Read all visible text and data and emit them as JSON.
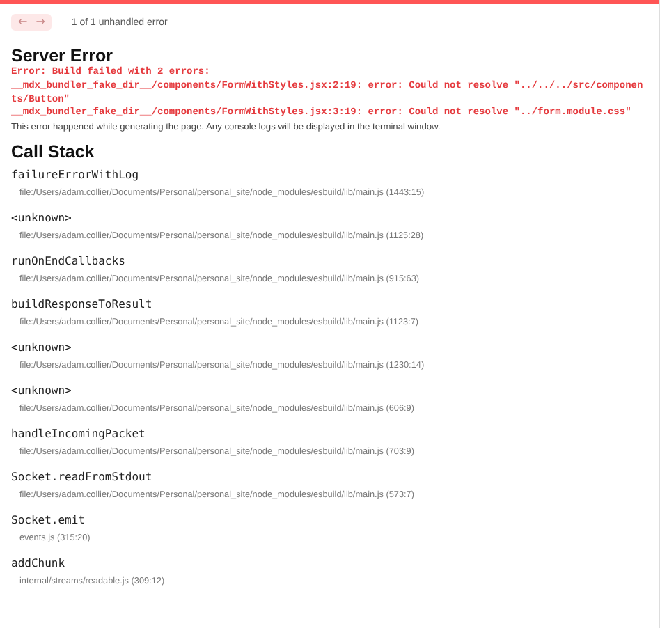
{
  "nav": {
    "buttons": [
      {
        "label": "←",
        "disabled": true
      },
      {
        "label": "→",
        "disabled": true
      }
    ],
    "counter": "1 of 1 unhandled error"
  },
  "error": {
    "title": "Server Error",
    "lines": [
      "Error: Build failed with 2 errors:",
      "__mdx_bundler_fake_dir__/components/FormWithStyles.jsx:2:19: error: Could not resolve \"../../../src/components/Button\"",
      "__mdx_bundler_fake_dir__/components/FormWithStyles.jsx:3:19: error: Could not resolve \"../form.module.css\""
    ],
    "note": "This error happened while generating the page. Any console logs will be displayed in the terminal window."
  },
  "call_stack": {
    "title": "Call Stack",
    "frames": [
      {
        "name": "failureErrorWithLog",
        "file": "file:/Users/adam.collier/Documents/Personal/personal_site/node_modules/esbuild/lib/main.js (1443:15)"
      },
      {
        "name": "<unknown>",
        "file": "file:/Users/adam.collier/Documents/Personal/personal_site/node_modules/esbuild/lib/main.js (1125:28)"
      },
      {
        "name": "runOnEndCallbacks",
        "file": "file:/Users/adam.collier/Documents/Personal/personal_site/node_modules/esbuild/lib/main.js (915:63)"
      },
      {
        "name": "buildResponseToResult",
        "file": "file:/Users/adam.collier/Documents/Personal/personal_site/node_modules/esbuild/lib/main.js (1123:7)"
      },
      {
        "name": "<unknown>",
        "file": "file:/Users/adam.collier/Documents/Personal/personal_site/node_modules/esbuild/lib/main.js (1230:14)"
      },
      {
        "name": "<unknown>",
        "file": "file:/Users/adam.collier/Documents/Personal/personal_site/node_modules/esbuild/lib/main.js (606:9)"
      },
      {
        "name": "handleIncomingPacket",
        "file": "file:/Users/adam.collier/Documents/Personal/personal_site/node_modules/esbuild/lib/main.js (703:9)"
      },
      {
        "name": "Socket.readFromStdout",
        "file": "file:/Users/adam.collier/Documents/Personal/personal_site/node_modules/esbuild/lib/main.js (573:7)"
      },
      {
        "name": "Socket.emit",
        "file": "events.js (315:20)"
      },
      {
        "name": "addChunk",
        "file": "internal/streams/readable.js (309:12)"
      }
    ]
  }
}
